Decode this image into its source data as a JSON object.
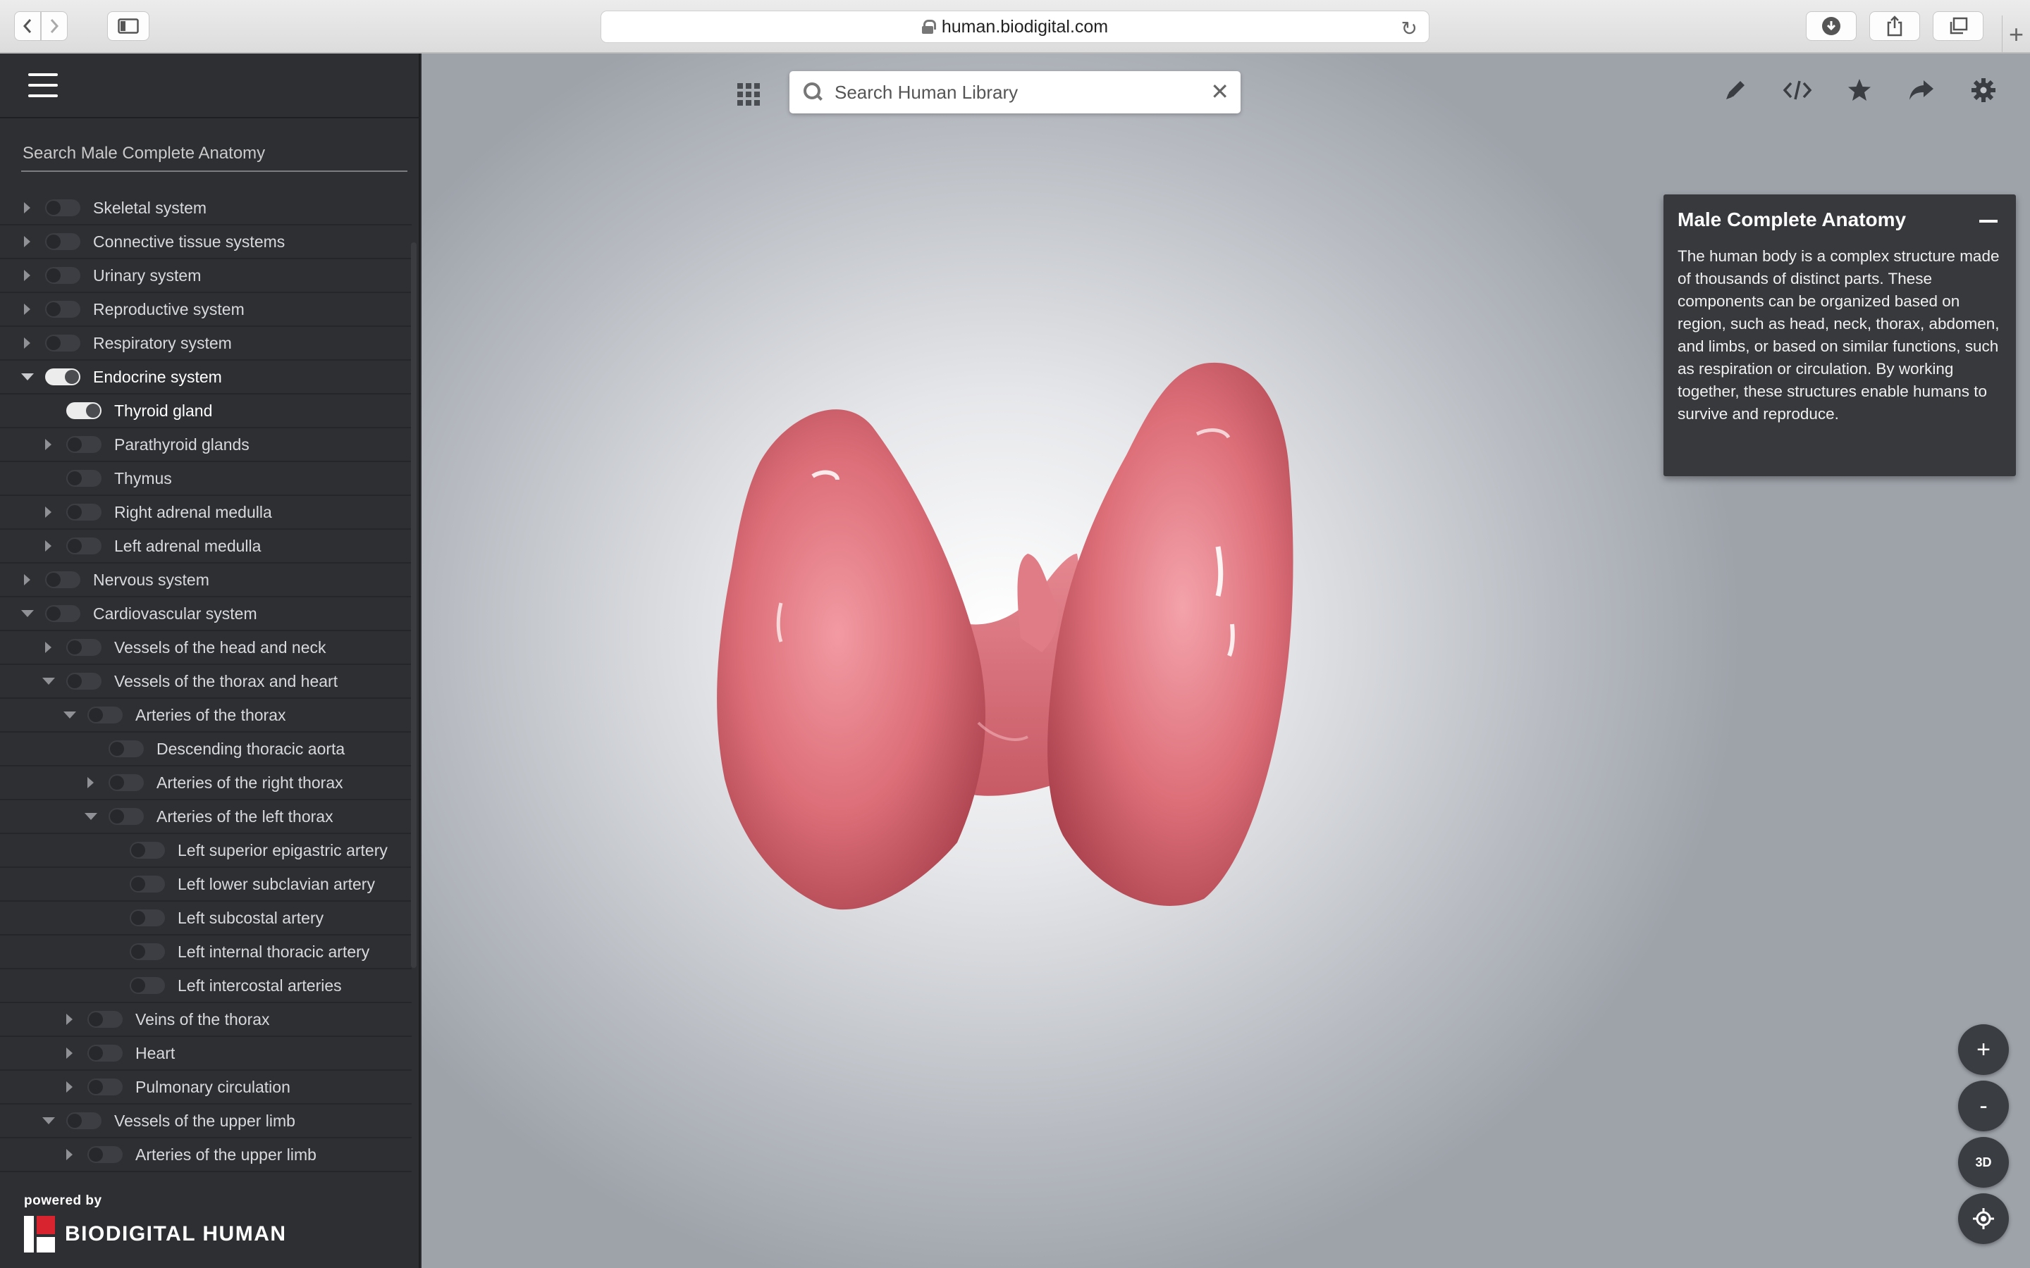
{
  "browser": {
    "url": "human.biodigital.com"
  },
  "sidebar": {
    "search_placeholder": "Search Male Complete Anatomy",
    "items": [
      {
        "label": "Skeletal system",
        "indent": 0,
        "arrow": "right",
        "on": false
      },
      {
        "label": "Connective tissue systems",
        "indent": 0,
        "arrow": "right",
        "on": false
      },
      {
        "label": "Urinary system",
        "indent": 0,
        "arrow": "right",
        "on": false
      },
      {
        "label": "Reproductive system",
        "indent": 0,
        "arrow": "right",
        "on": false
      },
      {
        "label": "Respiratory system",
        "indent": 0,
        "arrow": "right",
        "on": false
      },
      {
        "label": "Endocrine system",
        "indent": 0,
        "arrow": "down",
        "on": true
      },
      {
        "label": "Thyroid gland",
        "indent": 1,
        "arrow": "none",
        "on": true
      },
      {
        "label": "Parathyroid glands",
        "indent": 1,
        "arrow": "right",
        "on": false
      },
      {
        "label": "Thymus",
        "indent": 1,
        "arrow": "none",
        "on": false
      },
      {
        "label": "Right adrenal medulla",
        "indent": 1,
        "arrow": "right",
        "on": false
      },
      {
        "label": "Left adrenal medulla",
        "indent": 1,
        "arrow": "right",
        "on": false
      },
      {
        "label": "Nervous system",
        "indent": 0,
        "arrow": "right",
        "on": false
      },
      {
        "label": "Cardiovascular system",
        "indent": 0,
        "arrow": "down-dim",
        "on": false
      },
      {
        "label": "Vessels of the head and neck",
        "indent": 1,
        "arrow": "right",
        "on": false
      },
      {
        "label": "Vessels of the thorax and heart",
        "indent": 1,
        "arrow": "down-dim",
        "on": false
      },
      {
        "label": "Arteries of the thorax",
        "indent": 2,
        "arrow": "down-dim",
        "on": false
      },
      {
        "label": "Descending thoracic aorta",
        "indent": 3,
        "arrow": "none",
        "on": false
      },
      {
        "label": "Arteries of the right thorax",
        "indent": 3,
        "arrow": "right",
        "on": false
      },
      {
        "label": "Arteries of the left thorax",
        "indent": 3,
        "arrow": "down-dim",
        "on": false
      },
      {
        "label": "Left superior epigastric artery",
        "indent": 4,
        "arrow": "none",
        "on": false
      },
      {
        "label": "Left lower subclavian artery",
        "indent": 4,
        "arrow": "none",
        "on": false
      },
      {
        "label": "Left subcostal artery",
        "indent": 4,
        "arrow": "none",
        "on": false
      },
      {
        "label": "Left internal thoracic artery",
        "indent": 4,
        "arrow": "none",
        "on": false
      },
      {
        "label": "Left intercostal arteries",
        "indent": 4,
        "arrow": "none",
        "on": false
      },
      {
        "label": "Veins of the thorax",
        "indent": 2,
        "arrow": "right",
        "on": false
      },
      {
        "label": "Heart",
        "indent": 2,
        "arrow": "right",
        "on": false
      },
      {
        "label": "Pulmonary circulation",
        "indent": 2,
        "arrow": "right",
        "on": false
      },
      {
        "label": "Vessels of the upper limb",
        "indent": 1,
        "arrow": "down-dim",
        "on": false
      },
      {
        "label": "Arteries of the upper limb",
        "indent": 2,
        "arrow": "right",
        "on": false
      }
    ],
    "powered_by": "powered by",
    "brand": "BIODIGITAL HUMAN"
  },
  "viewer": {
    "search_placeholder": "Search Human Library",
    "info": {
      "title": "Male Complete Anatomy",
      "body": "The human body is a complex structure made of thousands of distinct parts. These components can be organized based on region, such as head, neck, thorax, abdomen, and limbs, or based on similar functions, such as respiration or circulation. By working together, these structures enable humans to survive and reproduce."
    },
    "zoom_in": "+",
    "zoom_out": "-",
    "rotate_label": "3D",
    "colors": {
      "tissue": "#d9656f",
      "tissue_dark": "#b84652",
      "panel": "#37393d"
    }
  }
}
